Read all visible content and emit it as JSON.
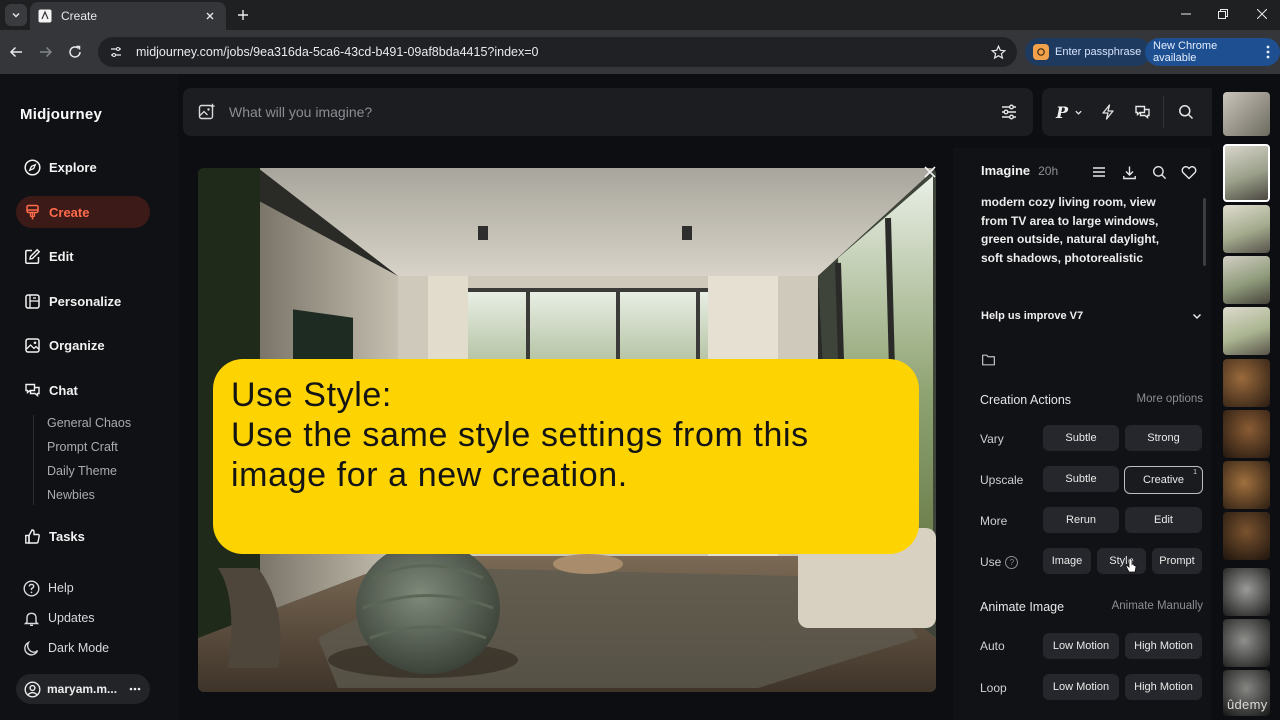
{
  "browser": {
    "tab_title": "Create",
    "url": "midjourney.com/jobs/9ea316da-5ca6-43cd-b491-09af8bda4415?index=0",
    "passphrase_label": "Enter passphrase",
    "update_label": "New Chrome available"
  },
  "sidebar": {
    "logo": "Midjourney",
    "nav": {
      "explore": "Explore",
      "create": "Create",
      "edit": "Edit",
      "personalize": "Personalize",
      "organize": "Organize",
      "chat": "Chat",
      "tasks": "Tasks"
    },
    "chat_rooms": [
      "General Chaos",
      "Prompt Craft",
      "Daily Theme",
      "Newbies"
    ],
    "footer": {
      "help": "Help",
      "updates": "Updates",
      "dark_mode": "Dark Mode",
      "user": "maryam.m..."
    }
  },
  "prompt_bar": {
    "placeholder": "What will you imagine?"
  },
  "top_tools": {
    "profile_letter": "P"
  },
  "callout": {
    "line1": "Use Style:",
    "line2": "Use the same style settings from this",
    "line3": "image for a new creation."
  },
  "details": {
    "title": "Imagine",
    "time_ago": "20h",
    "prompt": "modern cozy living room, view from TV area to large windows, green outside, natural daylight, soft shadows, photorealistic",
    "improve": "Help us improve V7",
    "creation_actions": "Creation Actions",
    "more_options": "More options",
    "vary_label": "Vary",
    "vary_subtle": "Subtle",
    "vary_strong": "Strong",
    "upscale_label": "Upscale",
    "upscale_subtle": "Subtle",
    "upscale_creative": "Creative",
    "upscale_creative_badge": "1",
    "more_label": "More",
    "rerun": "Rerun",
    "edit": "Edit",
    "use_label": "Use",
    "use_image": "Image",
    "use_style": "Style",
    "use_prompt": "Prompt",
    "animate_image": "Animate Image",
    "animate_manually": "Animate Manually",
    "auto_label": "Auto",
    "auto_low": "Low Motion",
    "auto_high": "High Motion",
    "loop_label": "Loop",
    "loop_low": "Low Motion",
    "loop_high": "High Motion"
  },
  "watermark": "ûdemy",
  "colors": {
    "accent_create": "#ff6a4b",
    "callout_yellow": "#fdd401",
    "chrome_blue": "#1d4f91"
  }
}
